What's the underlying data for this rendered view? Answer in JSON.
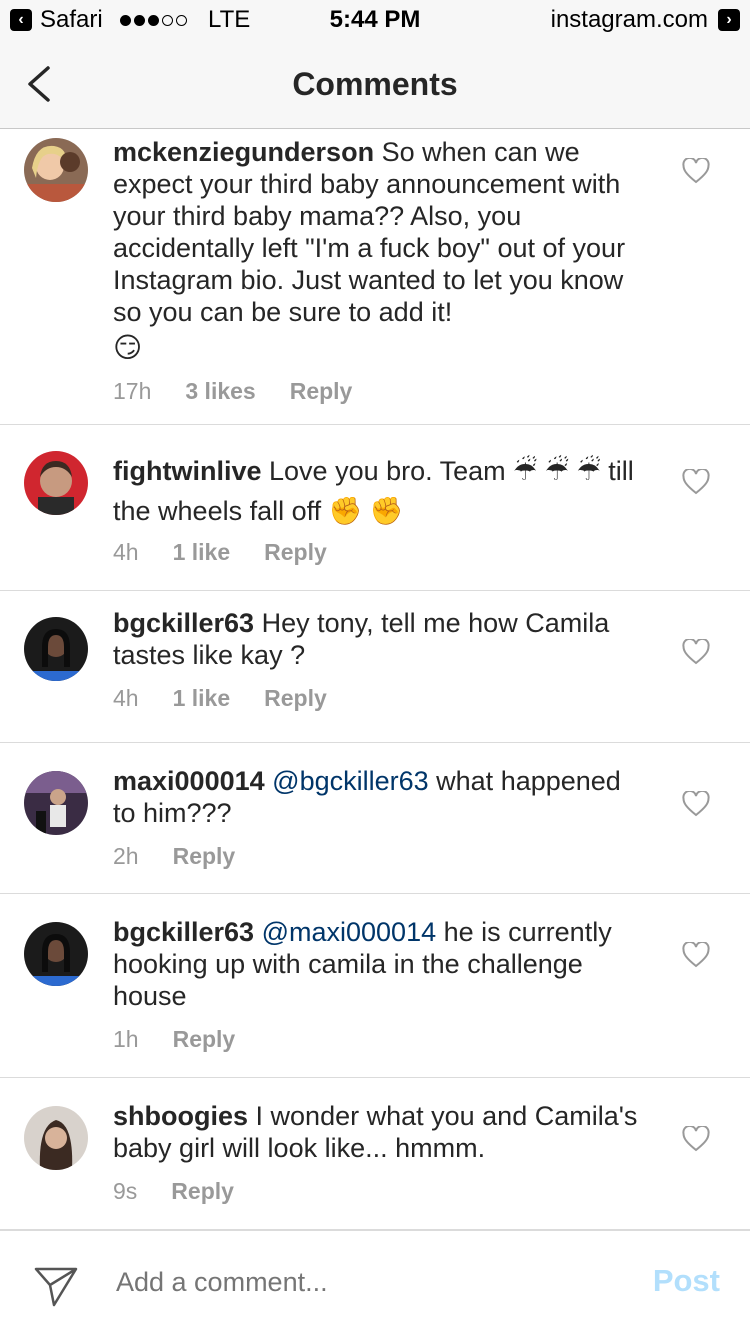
{
  "status_bar": {
    "back_app": "Safari",
    "network": "LTE",
    "time": "5:44 PM",
    "site": "instagram.com",
    "signal_bars_filled": 3,
    "signal_bars_total": 5
  },
  "nav": {
    "title": "Comments"
  },
  "comments": [
    {
      "username": "mckenziegunderson",
      "text": "So when can we expect your third baby announcement with your third baby mama?? Also, you accidentally left \"I'm a fuck boy\" out of your Instagram bio. Just wanted to let you know so you can be sure to add it!",
      "emoji": "😏",
      "time": "17h",
      "likes": "3 likes",
      "reply": "Reply"
    },
    {
      "username": "fightwinlive",
      "text": "Love you bro. Team ☔ ☔ ☔ till the wheels fall off ✊ ✊",
      "time": "4h",
      "likes": "1 like",
      "reply": "Reply"
    },
    {
      "username": "bgckiller63",
      "text": "Hey tony, tell me how Camila tastes like kay ?",
      "time": "4h",
      "likes": "1 like",
      "reply": "Reply"
    },
    {
      "username": "maxi000014",
      "mention": "@bgckiller63",
      "text": "what happened to him???",
      "time": "2h",
      "reply": "Reply"
    },
    {
      "username": "bgckiller63",
      "mention": "@maxi000014",
      "text": "he is currently hooking up with camila in the challenge house",
      "time": "1h",
      "reply": "Reply"
    },
    {
      "username": "shboogies",
      "text": "I wonder what you and Camila's baby girl will look like... hmmm.",
      "time": "9s",
      "reply": "Reply"
    }
  ],
  "composer": {
    "placeholder": "Add a comment...",
    "post_label": "Post"
  },
  "colors": {
    "mention": "#003569",
    "meta": "#999999",
    "post_disabled": "#b2dffc"
  }
}
